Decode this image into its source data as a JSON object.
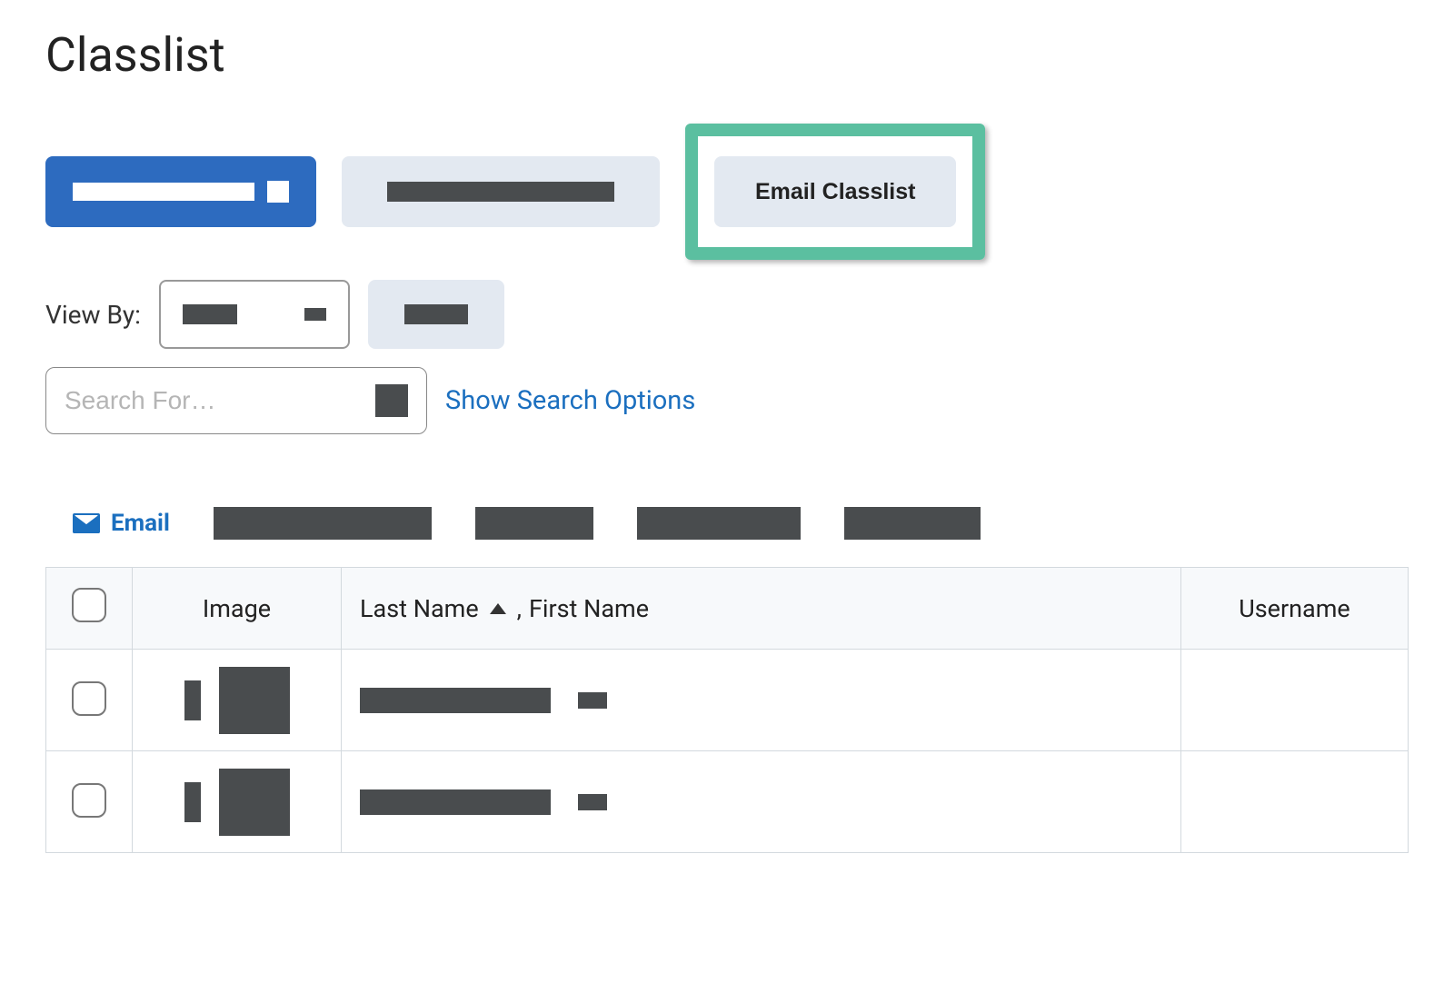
{
  "page": {
    "title": "Classlist"
  },
  "toolbar": {
    "email_classlist_label": "Email Classlist"
  },
  "viewby": {
    "label": "View By:"
  },
  "search": {
    "placeholder": "Search For…",
    "show_options_label": "Show Search Options"
  },
  "actions": {
    "email_label": "Email"
  },
  "table": {
    "headers": {
      "image": "Image",
      "last_name": "Last Name",
      "first_name": "First Name",
      "username": "Username",
      "name_separator": ","
    }
  }
}
